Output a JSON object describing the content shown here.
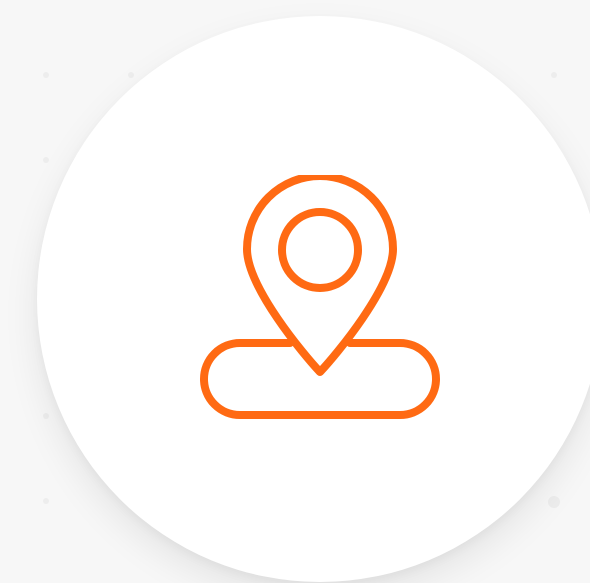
{
  "icon": {
    "name": "location-pin-icon",
    "stroke_color": "#FF6A13"
  },
  "colors": {
    "background": "#F7F7F7",
    "badge": "#FFFFFF",
    "dots": "#EDEDED"
  }
}
